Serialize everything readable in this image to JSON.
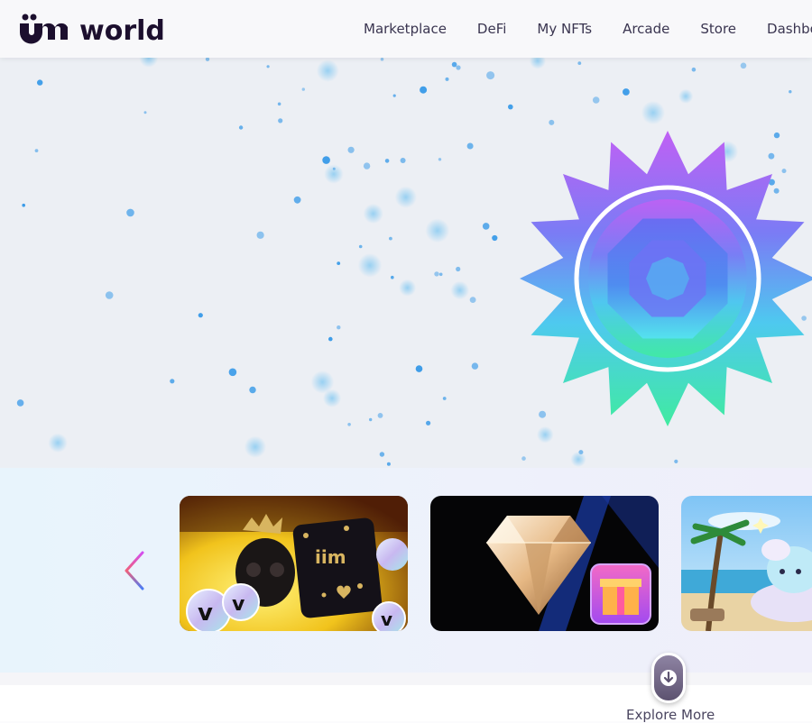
{
  "header": {
    "logo_text": "iim world",
    "nav": [
      "Marketplace",
      "DeFi",
      "My NFTs",
      "Arcade",
      "Store",
      "Dashboard"
    ]
  },
  "hero": {
    "emblem_icon": "gem-badge-icon",
    "colors": {
      "background": "#eceff4",
      "particles": "#3b9be8"
    }
  },
  "carousel": {
    "prev_icon": "chevron-left-icon",
    "cards": [
      {
        "name": "skull-nft-card",
        "icon": "skull-coins-image"
      },
      {
        "name": "diamond-gift-card",
        "icon": "diamond-gift-image"
      },
      {
        "name": "beach-pet-card",
        "icon": "beach-pet-image"
      }
    ]
  },
  "explore": {
    "label": "Explore More",
    "icon": "arrow-down-icon"
  }
}
